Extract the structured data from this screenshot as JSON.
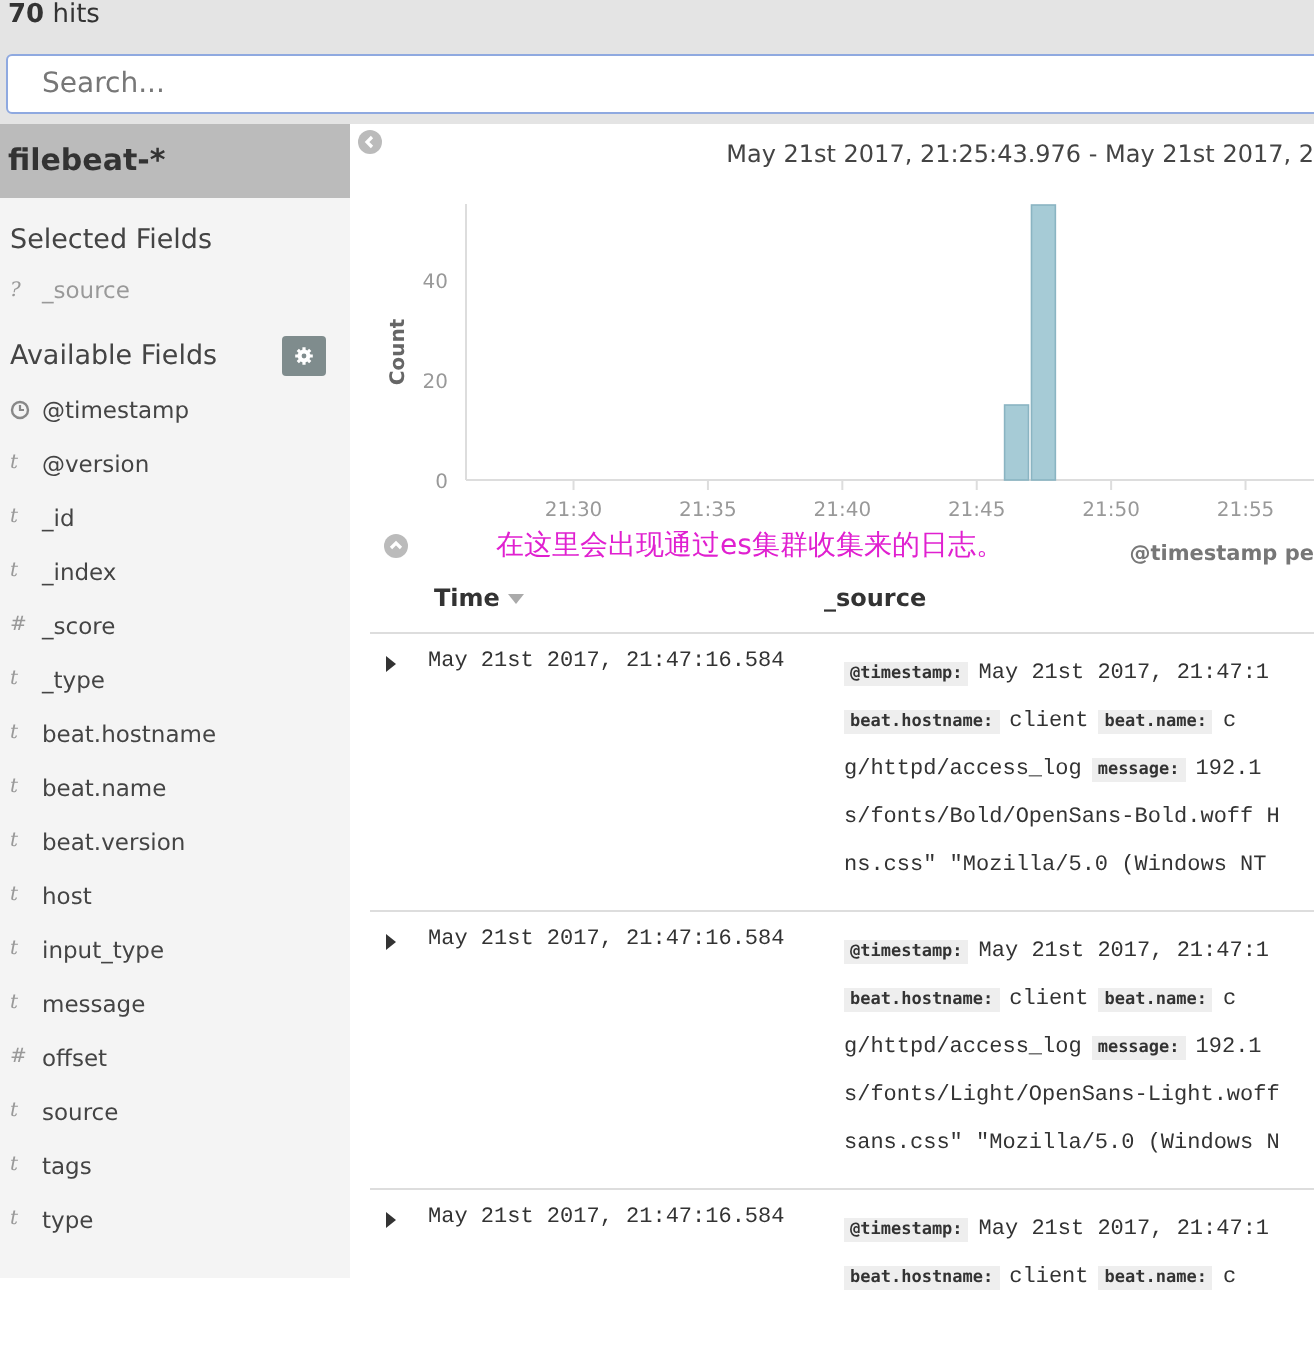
{
  "hits": "**70** hits",
  "search": {
    "placeholder": "Search..."
  },
  "index_pattern": "filebeat-*",
  "selected_fields": {
    "title": "Selected Fields",
    "items": [
      {
        "name": "_source",
        "kind": "unknown",
        "glyph": "?"
      }
    ]
  },
  "available_fields": {
    "title": "Available Fields",
    "items": [
      {
        "name": "@timestamp",
        "kind": "date"
      },
      {
        "name": "@version",
        "kind": "string",
        "glyph": "t"
      },
      {
        "name": "_id",
        "kind": "string",
        "glyph": "t"
      },
      {
        "name": "_index",
        "kind": "string",
        "glyph": "t"
      },
      {
        "name": "_score",
        "kind": "number",
        "glyph": "#"
      },
      {
        "name": "_type",
        "kind": "string",
        "glyph": "t"
      },
      {
        "name": "beat.hostname",
        "kind": "string",
        "glyph": "t"
      },
      {
        "name": "beat.name",
        "kind": "string",
        "glyph": "t"
      },
      {
        "name": "beat.version",
        "kind": "string",
        "glyph": "t"
      },
      {
        "name": "host",
        "kind": "string",
        "glyph": "t"
      },
      {
        "name": "input_type",
        "kind": "string",
        "glyph": "t"
      },
      {
        "name": "message",
        "kind": "string",
        "glyph": "t"
      },
      {
        "name": "offset",
        "kind": "number",
        "glyph": "#"
      },
      {
        "name": "source",
        "kind": "string",
        "glyph": "t"
      },
      {
        "name": "tags",
        "kind": "string",
        "glyph": "t"
      },
      {
        "name": "type",
        "kind": "string",
        "glyph": "t"
      }
    ]
  },
  "time_range": "May 21st 2017, 21:25:43.976 - May 21st 2017, 2",
  "chart": {
    "chart_data": {
      "type": "bar",
      "ylabel": "Count",
      "xlabel": "@timestamp pe",
      "categories": [
        null,
        null,
        null,
        null,
        "21:30",
        null,
        null,
        null,
        null,
        "21:35",
        null,
        null,
        null,
        null,
        "21:40",
        null,
        null,
        null,
        null,
        "21:45",
        null,
        null,
        null,
        null,
        "21:50",
        null,
        null,
        null,
        null,
        "21:55",
        null,
        null
      ],
      "values": [
        0,
        0,
        0,
        0,
        0,
        0,
        0,
        0,
        0,
        0,
        0,
        0,
        0,
        0,
        0,
        0,
        0,
        0,
        0,
        0,
        15,
        55,
        0,
        0,
        0,
        0,
        0,
        0,
        0,
        0,
        0,
        0
      ],
      "ylim": [
        0,
        55
      ],
      "yticks": [
        0,
        20,
        40
      ]
    }
  },
  "annotation": "在这里会出现通过es集群收集来的日志。",
  "table": {
    "columns": [
      {
        "label": "Time",
        "sorted": true
      },
      {
        "label": "_source",
        "sorted": false
      }
    ],
    "rows": [
      {
        "time": "May 21st 2017, 21:47:16.584",
        "source": [
          [
            {
              "kind": "key",
              "text": "@timestamp:"
            },
            {
              "kind": "value",
              "text": "May 21st 2017, 21:47:1"
            }
          ],
          [
            {
              "kind": "key",
              "text": "beat.hostname:"
            },
            {
              "kind": "value",
              "text": "client"
            },
            {
              "kind": "key",
              "text": "beat.name:"
            },
            {
              "kind": "value",
              "text": "c"
            }
          ],
          [
            {
              "kind": "value",
              "text": "g/httpd/access_log"
            },
            {
              "kind": "key",
              "text": "message:"
            },
            {
              "kind": "value",
              "text": "192.1"
            }
          ],
          [
            {
              "kind": "value",
              "text": "s/fonts/Bold/OpenSans-Bold.woff H"
            }
          ],
          [
            {
              "kind": "value",
              "text": "ns.css\" \"Mozilla/5.0 (Windows NT"
            }
          ]
        ]
      },
      {
        "time": "May 21st 2017, 21:47:16.584",
        "source": [
          [
            {
              "kind": "key",
              "text": "@timestamp:"
            },
            {
              "kind": "value",
              "text": "May 21st 2017, 21:47:1"
            }
          ],
          [
            {
              "kind": "key",
              "text": "beat.hostname:"
            },
            {
              "kind": "value",
              "text": "client"
            },
            {
              "kind": "key",
              "text": "beat.name:"
            },
            {
              "kind": "value",
              "text": "c"
            }
          ],
          [
            {
              "kind": "value",
              "text": "g/httpd/access_log"
            },
            {
              "kind": "key",
              "text": "message:"
            },
            {
              "kind": "value",
              "text": "192.1"
            }
          ],
          [
            {
              "kind": "value",
              "text": "s/fonts/Light/OpenSans-Light.woff"
            }
          ],
          [
            {
              "kind": "value",
              "text": "sans.css\" \"Mozilla/5.0 (Windows N"
            }
          ]
        ]
      },
      {
        "time": "May 21st 2017, 21:47:16.584",
        "source": [
          [
            {
              "kind": "key",
              "text": "@timestamp:"
            },
            {
              "kind": "value",
              "text": "May 21st 2017, 21:47:1"
            }
          ],
          [
            {
              "kind": "key",
              "text": "beat.hostname:"
            },
            {
              "kind": "value",
              "text": "client"
            },
            {
              "kind": "key",
              "text": "beat.name:"
            },
            {
              "kind": "value",
              "text": "c"
            }
          ]
        ]
      }
    ]
  }
}
